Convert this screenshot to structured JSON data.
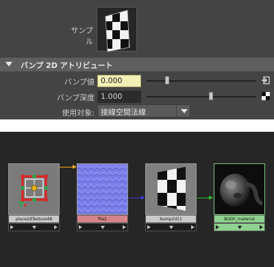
{
  "attribute_editor": {
    "sample_label": "サンプル",
    "section_title": "バンプ 2D アトリビュート",
    "bump_value": {
      "label": "バンプ値",
      "value": "0.000",
      "slider_fraction": 0.03
    },
    "bump_depth": {
      "label": "バンプ深度",
      "value": "1.000",
      "slider_fraction": 0.47
    },
    "use_as": {
      "label": "使用対象:",
      "selected": "接線空間法線"
    }
  },
  "node_editor": {
    "nodes": [
      {
        "name": "place2dTexture48",
        "icon": "place2d-texture-gizmo-icon",
        "name_bar_color": "#c9c9c9"
      },
      {
        "name": "file2",
        "icon": "normal-map-texture",
        "name_bar_color": "#d4858a"
      },
      {
        "name": "bump2d11",
        "icon": "checker-bump-icon",
        "name_bar_color": "#c9c9c9"
      },
      {
        "name": "BODY_material",
        "icon": "material-preview",
        "name_bar_color": "#8fd18f"
      }
    ],
    "connection_colors": {
      "uv": "#f5a623",
      "bump_in": "#3a3ad6",
      "bump_out": "#2fbf2f"
    }
  }
}
